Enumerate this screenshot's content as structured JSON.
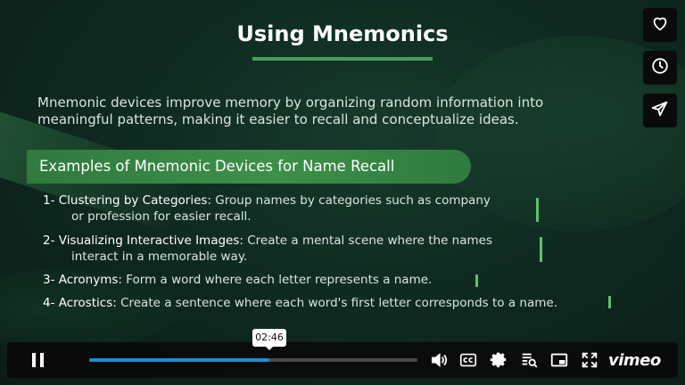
{
  "slide": {
    "title": "Using Mnemonics",
    "intro_line1": "Mnemonic devices improve memory by organizing random information into",
    "intro_line2": "meaningful patterns, making it easier to recall and conceptualize ideas.",
    "section_heading": "Examples of Mnemonic Devices for Name Recall",
    "items": [
      {
        "head": "1- Clustering by Categories:",
        "text": " Group names by categories such as company",
        "cont": "or profession for easier recall."
      },
      {
        "head": "2- Visualizing Interactive Images:",
        "text": " Create a mental scene where the names",
        "cont": "interact in a memorable way."
      },
      {
        "head": "3- Acronyms:",
        "text": " Form a word where each letter represents a name.",
        "cont": ""
      },
      {
        "head": "4- Acrostics:",
        "text": " Create a sentence where each word's first letter corresponds to a name.",
        "cont": ""
      }
    ]
  },
  "player": {
    "current_time": "02:46",
    "progress_fraction": 0.55,
    "brand": "vimeo",
    "side_buttons": [
      "heart-icon",
      "clock-icon",
      "send-icon"
    ],
    "controls": [
      "volume-icon",
      "cc-icon",
      "settings-icon",
      "transcript-icon",
      "pip-icon",
      "fullscreen-icon"
    ],
    "accent_color": "#1a8fd6"
  }
}
